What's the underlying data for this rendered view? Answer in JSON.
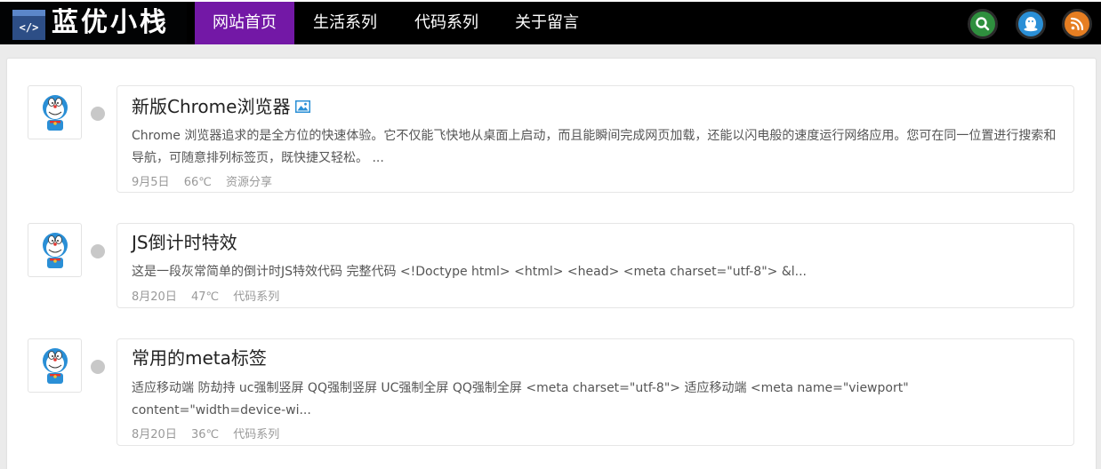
{
  "brand": {
    "badge_code": "</>",
    "name": "蓝优小栈"
  },
  "nav": [
    {
      "label": "网站首页",
      "active": true
    },
    {
      "label": "生活系列",
      "active": false
    },
    {
      "label": "代码系列",
      "active": false
    },
    {
      "label": "关于留言",
      "active": false
    }
  ],
  "header_buttons": [
    {
      "icon": "search-icon",
      "color": "#2f8f3e"
    },
    {
      "icon": "qq-icon",
      "color": "#2a8fd6"
    },
    {
      "icon": "rss-icon",
      "color": "#e67e22"
    }
  ],
  "colors": {
    "nav_active": "#7318a6",
    "topbar": "#000000",
    "page_bg": "#ebebeb"
  },
  "posts": [
    {
      "title": "新版Chrome浏览器",
      "has_image_icon": true,
      "excerpt": "Chrome 浏览器追求的是全方位的快速体验。它不仅能飞快地从桌面上启动，而且能瞬间完成网页加载，还能以闪电般的速度运行网络应用。您可在同一位置进行搜索和导航，可随意排列标签页，既快捷又轻松。 ...",
      "date": "9月5日",
      "views": "66℃",
      "category": "资源分享"
    },
    {
      "title": "JS倒计时特效",
      "has_image_icon": false,
      "excerpt": "这是一段灰常简单的倒计时JS特效代码 完整代码 <!Doctype html> <html> <head> <meta charset=\"utf-8\"> &l...",
      "date": "8月20日",
      "views": "47℃",
      "category": "代码系列"
    },
    {
      "title": "常用的meta标签",
      "has_image_icon": false,
      "excerpt": "适应移动端 防劫持 uc强制竖屏 QQ强制竖屏 UC强制全屏 QQ强制全屏 <meta charset=\"utf-8\"> 适应移动端 <meta name=\"viewport\" content=\"width=device-wi...",
      "date": "8月20日",
      "views": "36℃",
      "category": "代码系列"
    }
  ]
}
